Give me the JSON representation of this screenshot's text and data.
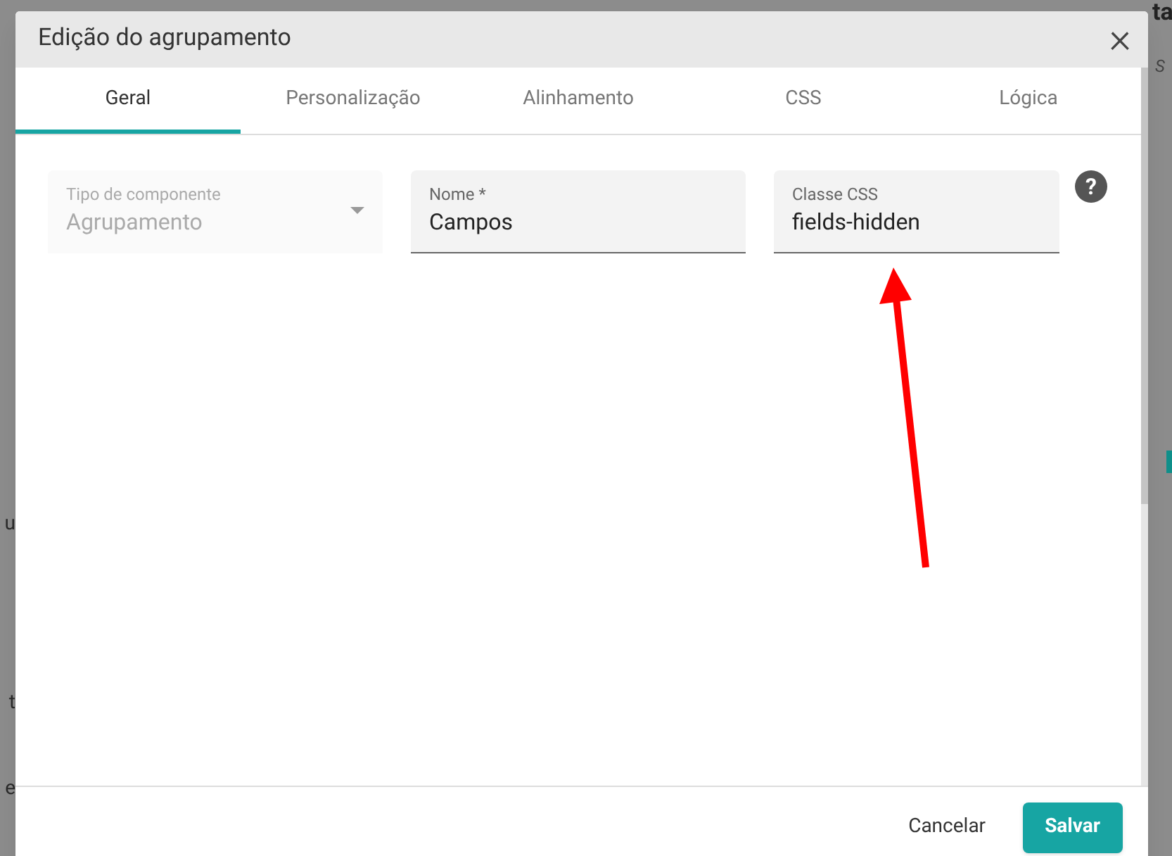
{
  "background": {
    "left_fragments": [
      "u",
      "t",
      "e"
    ],
    "right_heading": "ta",
    "right_subtitle": "S"
  },
  "dialog": {
    "title": "Edição do agrupamento",
    "close": "×",
    "tabs": [
      {
        "label": "Geral",
        "selected": true
      },
      {
        "label": "Personalização",
        "selected": false
      },
      {
        "label": "Alinhamento",
        "selected": false
      },
      {
        "label": "CSS",
        "selected": false
      },
      {
        "label": "Lógica",
        "selected": false
      }
    ],
    "fields": [
      {
        "kind": "select",
        "label": "Tipo de componente",
        "value": "Agrupamento",
        "disabled": true
      },
      {
        "kind": "text",
        "label": "Nome *",
        "value": "Campos",
        "disabled": false
      },
      {
        "kind": "text",
        "label": "Classe CSS",
        "value": "fields-hidden",
        "disabled": false
      }
    ],
    "help": "?",
    "buttons": [
      {
        "kind": "flat",
        "label": "Cancelar"
      },
      {
        "kind": "primary",
        "label": "Salvar"
      }
    ]
  }
}
